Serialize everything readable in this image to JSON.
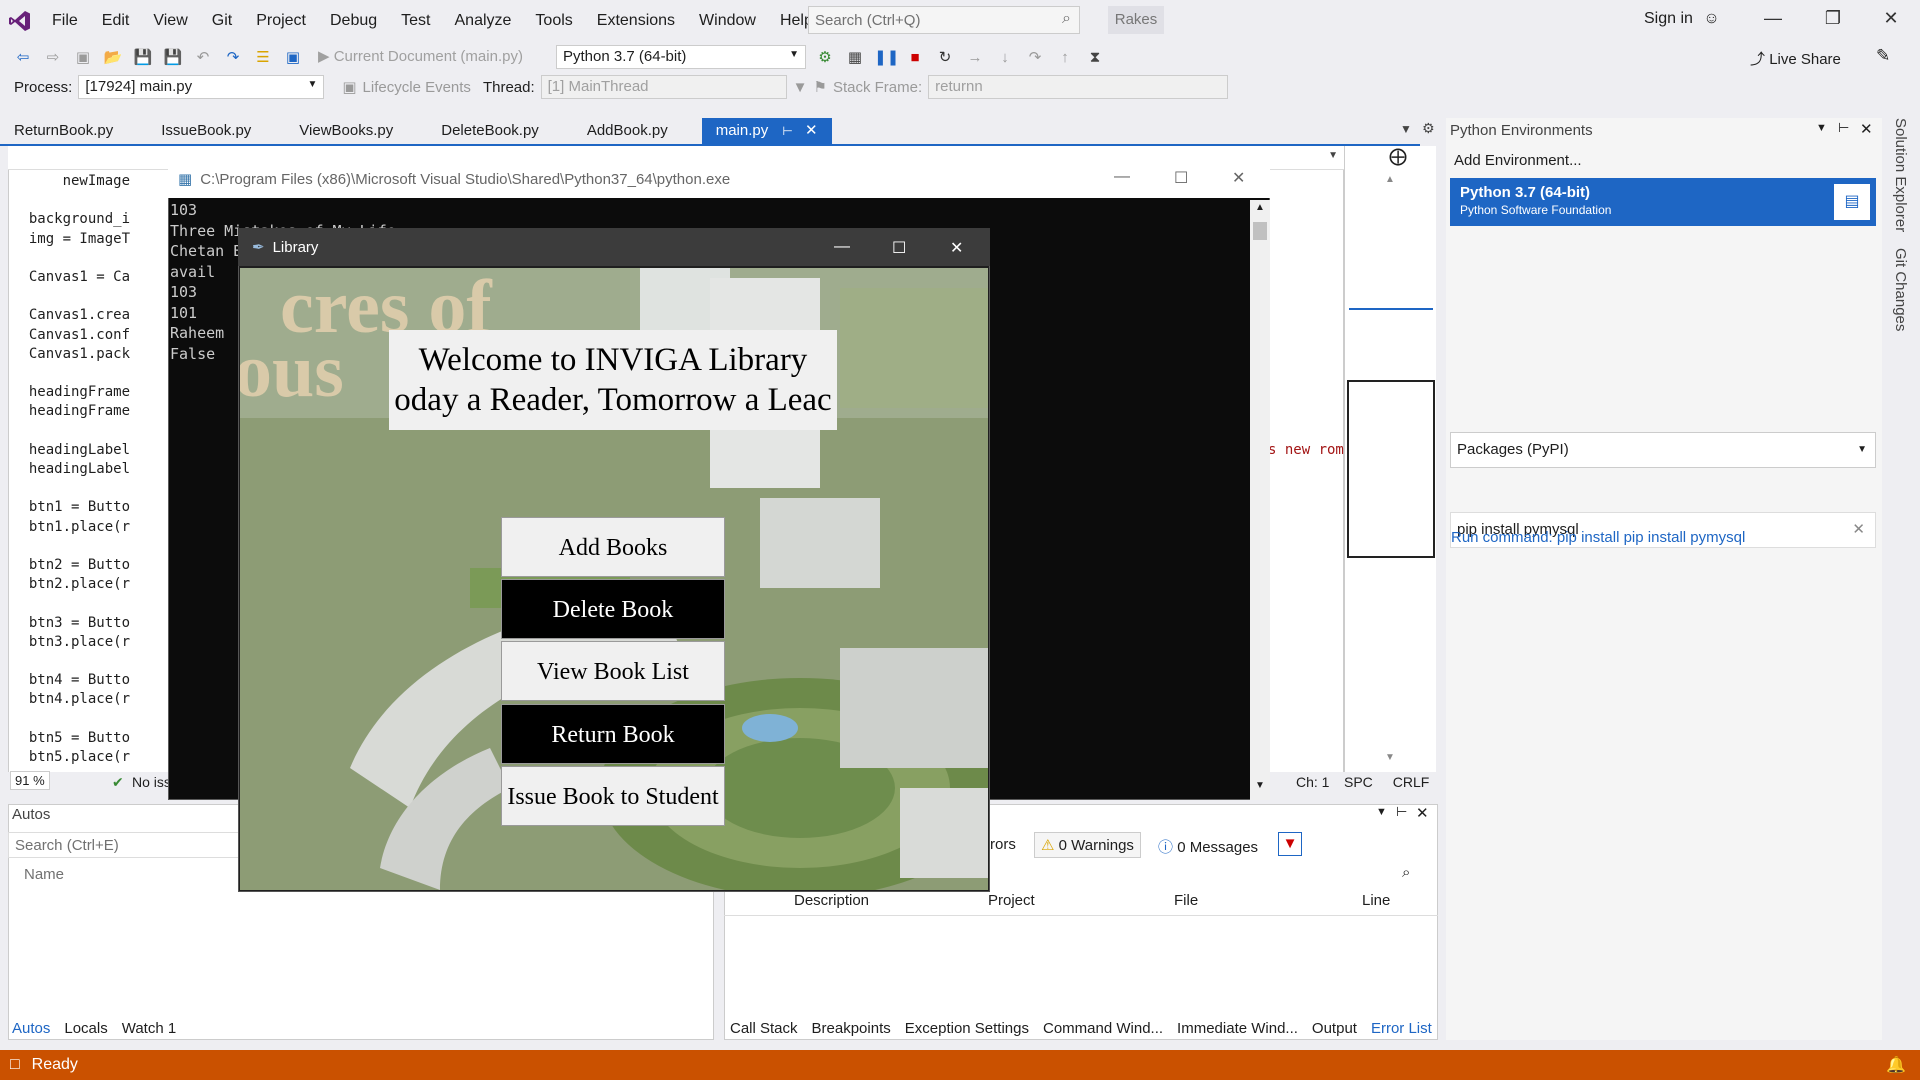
{
  "menubar": {
    "items": [
      "File",
      "Edit",
      "View",
      "Git",
      "Project",
      "Debug",
      "Test",
      "Analyze",
      "Tools",
      "Extensions",
      "Window",
      "Help"
    ],
    "search_placeholder": "Search (Ctrl+Q)",
    "solution_name": "Rakes",
    "sign_in": "Sign in",
    "live_share": "Live Share"
  },
  "toolbar": {
    "current_document": "Current Document (main.py)",
    "python_env": "Python 3.7 (64-bit)",
    "process_label": "Process:",
    "process_value": "[17924] main.py",
    "lifecycle": "Lifecycle Events",
    "thread_label": "Thread:",
    "thread_value": "[1] MainThread",
    "stackframe_label": "Stack Frame:",
    "stackframe_value": "returnn"
  },
  "tabs": [
    "ReturnBook.py",
    "IssueBook.py",
    "ViewBooks.py",
    "DeleteBook.py",
    "AddBook.py",
    "main.py"
  ],
  "editor": {
    "code_lines": [
      "      newImage",
      "",
      "  background_i",
      "  img = ImageT",
      "",
      "  Canvas1 = Ca",
      "",
      "  Canvas1.crea",
      "  Canvas1.conf",
      "  Canvas1.pack",
      "",
      "  headingFrame",
      "  headingFrame",
      "",
      "  headingLabel",
      "  headingLabel",
      "",
      "  btn1 = Butto",
      "  btn1.place(r",
      "",
      "  btn2 = Butto",
      "  btn2.place(r",
      "",
      "  btn3 = Butto",
      "  btn3.place(r",
      "",
      "  btn4 = Butto",
      "  btn4.place(r",
      "",
      "  btn5 = Butto",
      "  btn5.place(r"
    ],
    "right_code_fragment": "s new roma",
    "zoom": "91 %",
    "no_issues": "No iss",
    "ch": "Ch: 1",
    "spc": "SPC",
    "crlf": "CRLF"
  },
  "python_env_panel": {
    "title": "Python Environments",
    "add_env": "Add Environment...",
    "env_name": "Python 3.7 (64-bit)",
    "env_vendor": "Python Software Foundation",
    "packages_dropdown": "Packages (PyPI)",
    "pip_input": "pip install pymysql",
    "run_command": "Run command: pip install pip install pymysql"
  },
  "side_tabs": [
    "Solution Explorer",
    "Git Changes"
  ],
  "autos": {
    "title": "Autos",
    "search_placeholder": "Search (Ctrl+E)",
    "column_name": "Name",
    "tabs": [
      "Autos",
      "Locals",
      "Watch 1"
    ]
  },
  "errorlist": {
    "errors_fragment": "rors",
    "warnings": "0 Warnings",
    "messages": "0 Messages",
    "columns": [
      "Description",
      "Project",
      "File",
      "Line"
    ],
    "tabs": [
      "Call Stack",
      "Breakpoints",
      "Exception Settings",
      "Command Wind...",
      "Immediate Wind...",
      "Output",
      "Error List"
    ]
  },
  "status": {
    "text": "Ready"
  },
  "console": {
    "title": "C:\\Program Files (x86)\\Microsoft Visual Studio\\Shared\\Python37_64\\python.exe",
    "lines": [
      "103",
      "Three Mistakes of My Life",
      "Chetan B",
      "avail",
      "103",
      "101",
      "Raheem",
      "False"
    ]
  },
  "library": {
    "title": "Library",
    "bg_text_1": "cres of",
    "bg_text_2": "ous",
    "heading_line1": "Welcome to INVIGA Library",
    "heading_line2": "oday a Reader, Tomorrow a Leac",
    "buttons": [
      "Add Books",
      "Delete Book",
      "View Book List",
      "Return Book",
      "Issue Book to Student"
    ]
  },
  "colors": {
    "accent": "#1e66c4",
    "status_bar": "#ca5100",
    "console_bg": "#0c0c0c"
  }
}
